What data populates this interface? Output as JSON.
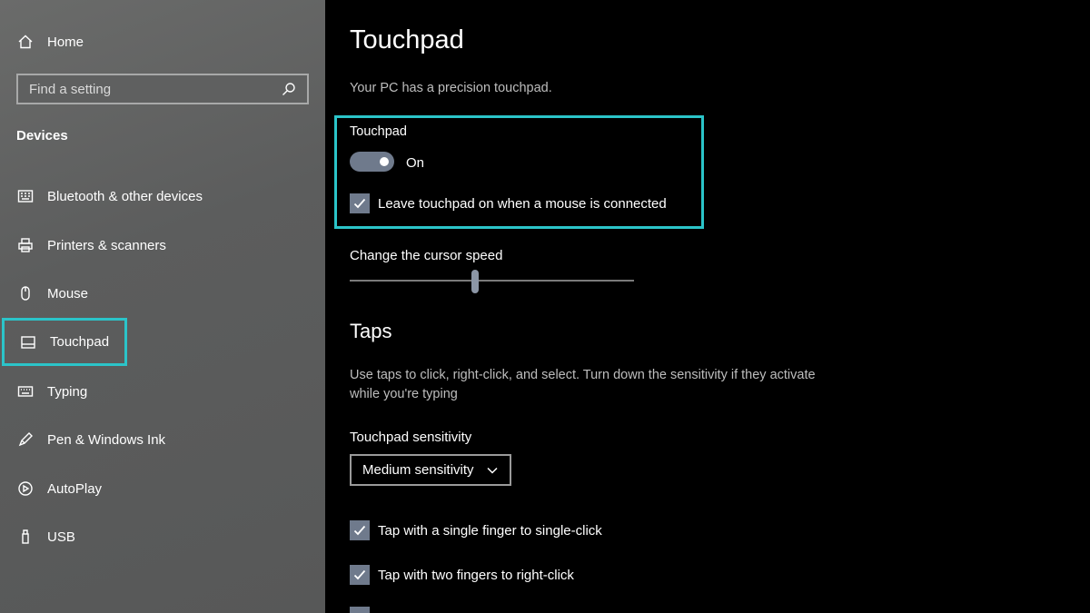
{
  "sidebar": {
    "home_label": "Home",
    "search_placeholder": "Find a setting",
    "section_title": "Devices",
    "items": [
      {
        "label": "Bluetooth & other devices",
        "icon": "bluetooth-keyboard-icon"
      },
      {
        "label": "Printers & scanners",
        "icon": "printer-icon"
      },
      {
        "label": "Mouse",
        "icon": "mouse-icon"
      },
      {
        "label": "Touchpad",
        "icon": "touchpad-icon",
        "selected": true
      },
      {
        "label": "Typing",
        "icon": "keyboard-icon"
      },
      {
        "label": "Pen & Windows Ink",
        "icon": "pen-icon"
      },
      {
        "label": "AutoPlay",
        "icon": "autoplay-icon"
      },
      {
        "label": "USB",
        "icon": "usb-icon"
      }
    ]
  },
  "main": {
    "title": "Touchpad",
    "subtitle": "Your PC has a precision touchpad.",
    "touchpad_label": "Touchpad",
    "toggle_state": "On",
    "toggle_on": true,
    "leave_on_label": "Leave touchpad on when a mouse is connected",
    "leave_on_checked": true,
    "cursor_speed_label": "Change the cursor speed",
    "cursor_speed_fraction": 0.44,
    "taps_heading": "Taps",
    "taps_description": "Use taps to click, right-click, and select. Turn down the sensitivity if they activate while you're typing",
    "sensitivity_label": "Touchpad sensitivity",
    "sensitivity_value": "Medium sensitivity",
    "tap_single_label": "Tap with a single finger to single-click",
    "tap_single_checked": true,
    "tap_two_label": "Tap with two fingers to right-click",
    "tap_two_checked": true
  },
  "colors": {
    "accent_highlight": "#2bc4c9",
    "control_fill": "#6f7a8c",
    "background": "#000000"
  }
}
